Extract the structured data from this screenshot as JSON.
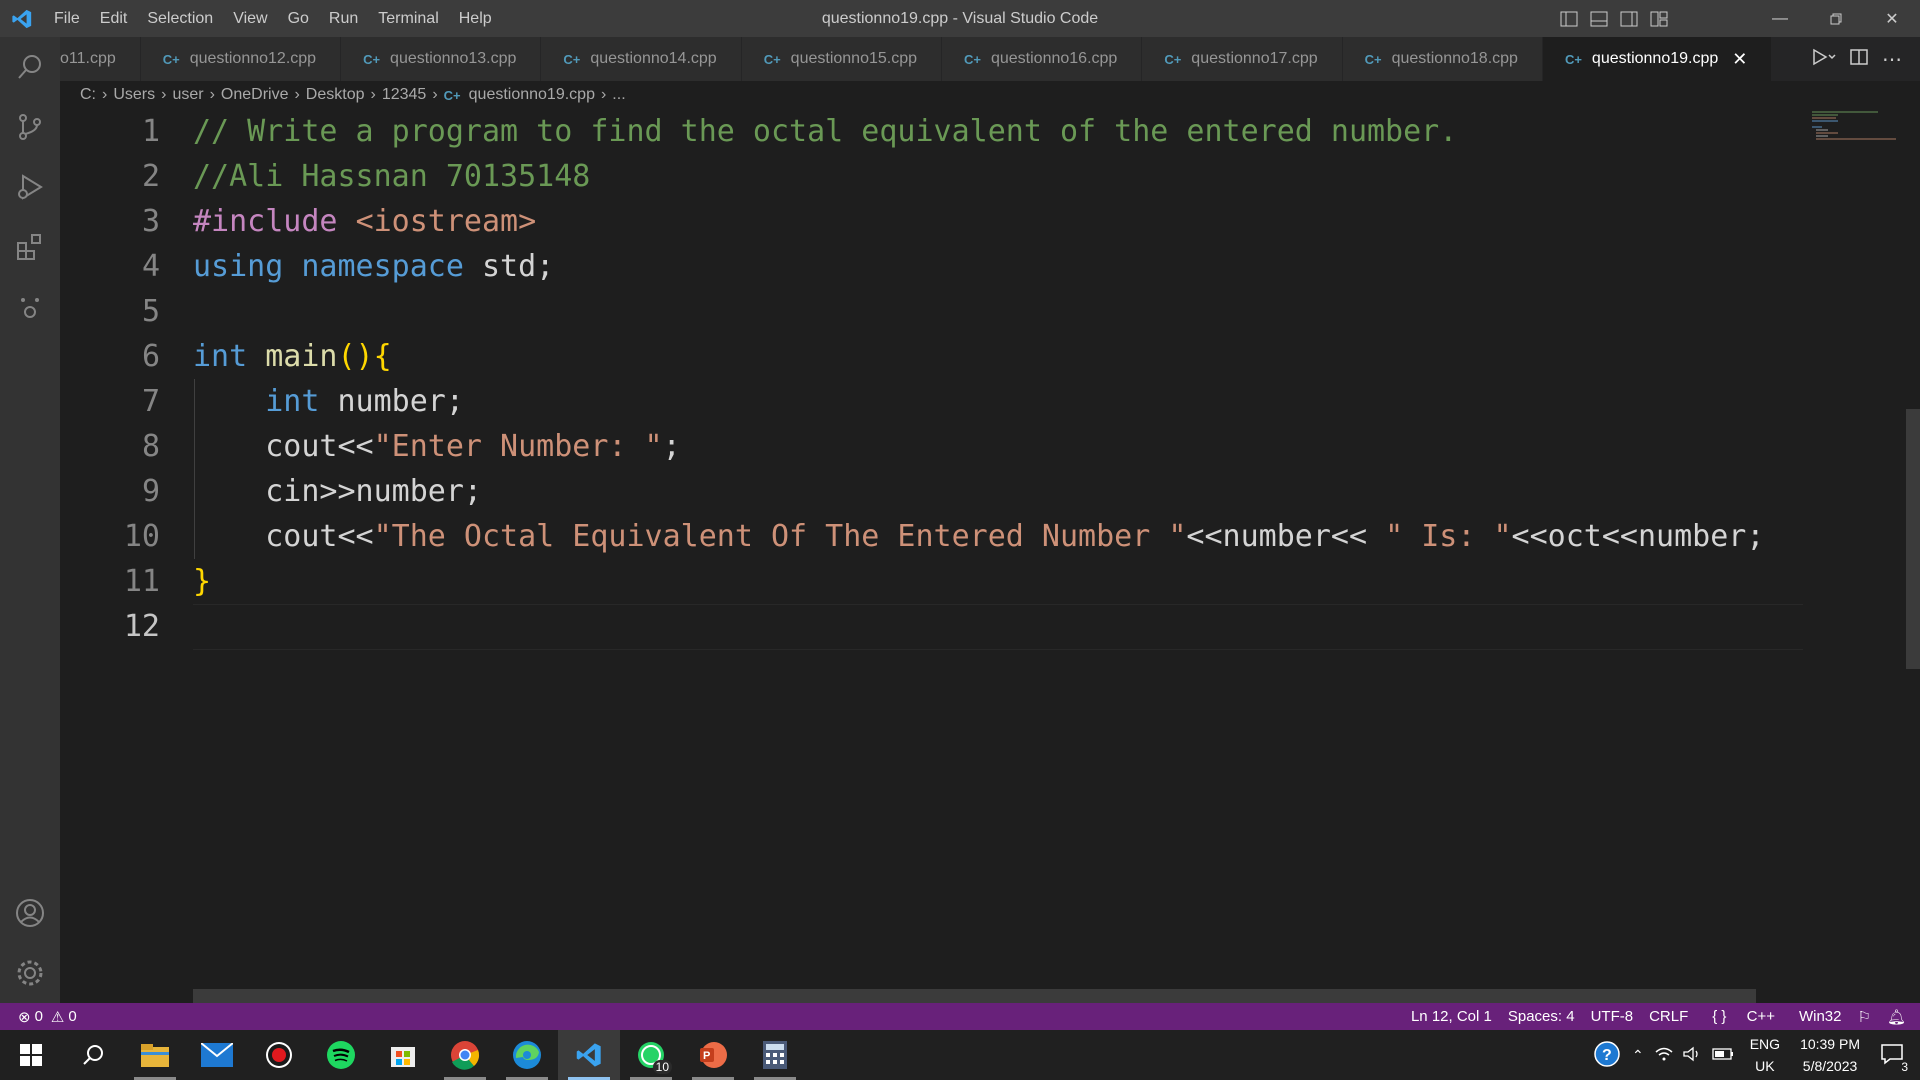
{
  "window": {
    "title": "questionno19.cpp - Visual Studio Code"
  },
  "menu": [
    "File",
    "Edit",
    "Selection",
    "View",
    "Go",
    "Run",
    "Terminal",
    "Help"
  ],
  "tabs": [
    {
      "label": "o11.cpp",
      "active": false,
      "icon": false
    },
    {
      "label": "questionno12.cpp",
      "active": false,
      "icon": true
    },
    {
      "label": "questionno13.cpp",
      "active": false,
      "icon": true
    },
    {
      "label": "questionno14.cpp",
      "active": false,
      "icon": true
    },
    {
      "label": "questionno15.cpp",
      "active": false,
      "icon": true
    },
    {
      "label": "questionno16.cpp",
      "active": false,
      "icon": true
    },
    {
      "label": "questionno17.cpp",
      "active": false,
      "icon": true
    },
    {
      "label": "questionno18.cpp",
      "active": false,
      "icon": true
    },
    {
      "label": "questionno19.cpp",
      "active": true,
      "icon": true
    }
  ],
  "breadcrumb": [
    "C:",
    "Users",
    "user",
    "OneDrive",
    "Desktop",
    "12345",
    "questionno19.cpp",
    "..."
  ],
  "editor": {
    "line_numbers": [
      "1",
      "2",
      "3",
      "4",
      "5",
      "6",
      "7",
      "8",
      "9",
      "10",
      "11",
      "12"
    ],
    "current_line": "12"
  },
  "status": {
    "errors": "0",
    "warnings": "0",
    "position": "Ln 12, Col 1",
    "spaces": "Spaces: 4",
    "encoding": "UTF-8",
    "eol": "CRLF",
    "language": "C++",
    "platform": "Win32"
  },
  "taskbar": {
    "whatsapp_badge": "10",
    "lang_top": "ENG",
    "lang_bottom": "UK",
    "time": "10:39 PM",
    "date": "5/8/2023",
    "notifications": "3"
  },
  "colors": {
    "statusbar": "#68217a",
    "accent": "#007acc"
  }
}
